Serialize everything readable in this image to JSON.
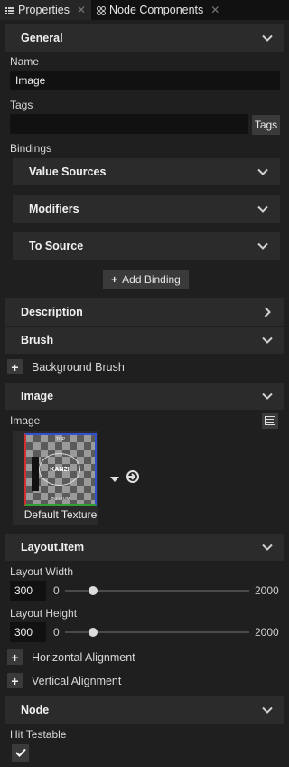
{
  "tabs": [
    {
      "label": "Properties",
      "icon": "list-icon",
      "active": true
    },
    {
      "label": "Node Components",
      "icon": "components-icon",
      "active": false
    }
  ],
  "sections": {
    "general": "General",
    "description": "Description",
    "brush": "Brush",
    "image": "Image",
    "layout_item": "Layout.Item",
    "node": "Node"
  },
  "general": {
    "name_label": "Name",
    "name_value": "Image",
    "tags_label": "Tags",
    "tags_value": "",
    "tags_button": "Tags",
    "bindings_label": "Bindings",
    "bindings": [
      "Value Sources",
      "Modifiers",
      "To Source"
    ],
    "add_binding": "Add Binding"
  },
  "brush": {
    "background_brush": "Background Brush"
  },
  "image": {
    "label": "Image",
    "texture_caption": "Default Texture",
    "texture_text": {
      "top": "TOP",
      "bottom": "BOTTOM",
      "center": "KANZI"
    }
  },
  "layout": {
    "width_label": "Layout Width",
    "width_value": "300",
    "width_fraction": 0.15,
    "height_label": "Layout Height",
    "height_value": "300",
    "height_fraction": 0.15,
    "min": "0",
    "max": "2000",
    "horizontal_alignment": "Horizontal Alignment",
    "vertical_alignment": "Vertical Alignment"
  },
  "node": {
    "hit_testable_label": "Hit Testable",
    "hit_testable": true
  },
  "colors": {
    "panel": "#1f1f1f",
    "section": "#2b2b2b",
    "field": "#111111",
    "button": "#3a3a3a"
  }
}
